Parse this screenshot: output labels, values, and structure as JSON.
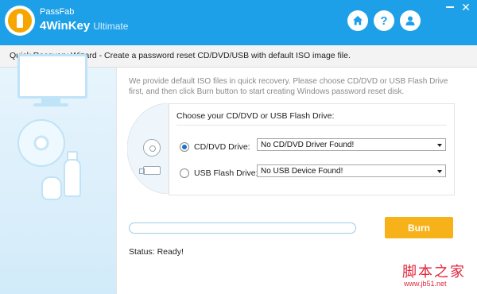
{
  "app": {
    "brand_small": "PassFab",
    "brand_big": "4WinKey",
    "edition": "Ultimate",
    "accent": "#1ea0e8"
  },
  "titlebar_buttons": [
    {
      "icon": "home-icon"
    },
    {
      "icon": "help-icon",
      "glyph": "?"
    },
    {
      "icon": "account-icon"
    }
  ],
  "window_controls": {
    "minimize": "minimize-icon",
    "close_glyph": "✕"
  },
  "wizard": {
    "caption": "Quick Recovery Wizard - Create a password reset CD/DVD/USB with default ISO image file.",
    "intro": "We provide default ISO files in quick recovery. Please choose CD/DVD or USB Flash Drive first, and then click Burn button to start creating Windows password reset disk.",
    "choose_title": "Choose your CD/DVD or USB Flash Drive:",
    "options": [
      {
        "label": "CD/DVD Drive:",
        "checked": true,
        "value": "No CD/DVD Driver Found!"
      },
      {
        "label": "USB Flash Drive:",
        "checked": false,
        "value": "No USB Device Found!"
      }
    ],
    "progress": 0,
    "burn_label": "Burn",
    "burn_color": "#f7b219",
    "status": "Status: Ready!"
  },
  "watermark": {
    "big": "脚本之家",
    "small": "www.jb51.net"
  }
}
